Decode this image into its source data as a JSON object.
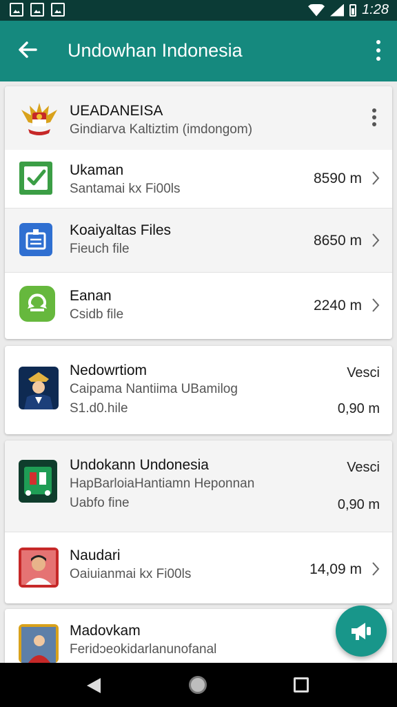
{
  "status_bar": {
    "time": "1:28",
    "left_icons": [
      "image-notification-icon",
      "photo-notification-icon",
      "gallery-notification-icon"
    ],
    "right_icons": [
      "wifi-icon",
      "signal-icon",
      "battery-icon"
    ]
  },
  "app_bar": {
    "title": "Undowhan Indonesia",
    "back_icon": "arrow-left-icon",
    "menu_icon": "more-vert-icon"
  },
  "cards": [
    {
      "header": {
        "title": "UEADANEISA",
        "subtitle": "Gindiarva Kaltiztim (imdongom)",
        "icon": "garuda-emblem-icon"
      },
      "rows": [
        {
          "title": "Ukaman",
          "subtitle": "Santamai kx Fi00ls",
          "meta": "8590 m",
          "icon": "green-check-icon",
          "color": "#3b9e45"
        },
        {
          "title": "Koaiyaltas Files",
          "subtitle": "Fieuch file",
          "meta": "8650 m",
          "icon": "blue-document-icon",
          "color": "#2f6fd1"
        },
        {
          "title": "Eanan",
          "subtitle": "Csidb file",
          "meta": "2240 m",
          "icon": "green-sync-icon",
          "color": "#66b83d"
        }
      ]
    },
    {
      "title": "Nedowrtiom",
      "line2": "Caipama Nantiima UBamilog",
      "line3": "S1.d0.hile",
      "badge": "Vesci",
      "meta": "0,90 m",
      "icon": "officer-portrait-icon"
    },
    {
      "title": "Undokann Undonesia",
      "line2": "HapBarloiaHantiamn Heponnan",
      "line3": "Uabfo fine",
      "badge": "Vesci",
      "meta": "0,90 m",
      "icon": "green-game-icon",
      "extra_row": {
        "title": "Naudari",
        "subtitle": "Oaiuianmai kx Fi00ls",
        "meta": "14,09 m",
        "icon": "portrait-photo-icon"
      }
    },
    {
      "title": "Madovkam",
      "line2": "Feridɔeokidarlanunofanal",
      "icon": "people-photo-icon"
    }
  ],
  "fab": {
    "icon": "megaphone-icon"
  },
  "nav_bar": {
    "icons": [
      "nav-back-icon",
      "nav-home-icon",
      "nav-recent-icon"
    ]
  }
}
